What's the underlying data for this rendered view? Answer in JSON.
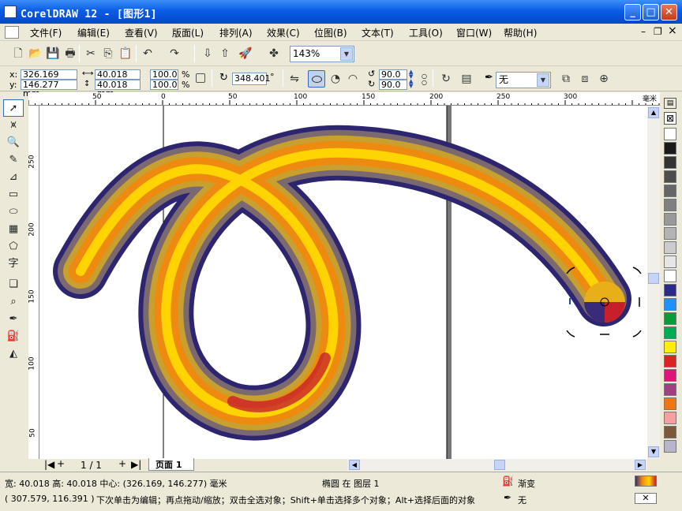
{
  "window": {
    "title": "CorelDRAW 12 - [图形1]",
    "min": "_",
    "max": "□",
    "close": "✕"
  },
  "menu": [
    {
      "label": "文件(F)"
    },
    {
      "label": "编辑(E)"
    },
    {
      "label": "查看(V)"
    },
    {
      "label": "版面(L)"
    },
    {
      "label": "排列(A)"
    },
    {
      "label": "效果(C)"
    },
    {
      "label": "位图(B)"
    },
    {
      "label": "文本(T)"
    },
    {
      "label": "工具(O)"
    },
    {
      "label": "窗口(W)"
    },
    {
      "label": "帮助(H)"
    }
  ],
  "doc_controls": {
    "min": "–",
    "restore": "❐",
    "close": "×"
  },
  "toolbar": {
    "zoom": "143%"
  },
  "property_bar": {
    "x_label": "x:",
    "x_value": "326.169 mm",
    "y_label": "y:",
    "y_value": "146.277 mm",
    "w_value": "40.018 mm",
    "h_value": "40.018 mm",
    "scale_x": "100.0",
    "scale_y": "100.0",
    "pct": "%",
    "angle": "348.401",
    "deg": "°",
    "arc_start": "90.0",
    "arc_end": "90.0",
    "outline": "无"
  },
  "ruler": {
    "unit": "毫米",
    "h_ticks": [
      "50",
      "0",
      "50",
      "100",
      "150",
      "200",
      "250",
      "300"
    ],
    "v_ticks": [
      "250",
      "200",
      "150",
      "100",
      "50"
    ]
  },
  "page": {
    "count": "1 / 1",
    "tab": "页面 1",
    "first": "|◀",
    "add": "+",
    "last": "▶|"
  },
  "status": {
    "dims": "宽: 40.018 高: 40.018 中心: (326.169, 146.277) 毫米",
    "object": "椭圆 在 图层 1",
    "fill_label": "渐变",
    "coords": "( 307.579, 116.391 )",
    "hint": "下次单击为编辑；再点拖动/缩放；双击全选对象；Shift+单击选择多个对象；Alt+选择后面的对象",
    "outline_label": "无"
  },
  "colors": {
    "accent": "#0a5de6",
    "tube_dark": "#3a2a7a",
    "tube_orange": "#ee8a10",
    "tube_yellow": "#ffd400",
    "tube_red": "#c8202a"
  },
  "palette": [
    "#ffffff",
    "#1a1a1a",
    "#333333",
    "#4d4d4d",
    "#666666",
    "#808080",
    "#999999",
    "#b3b3b3",
    "#cccccc",
    "#e6e6e6",
    "#ffffff",
    "#2a2a8a",
    "#1e90ff",
    "#0a9a3a",
    "#00aa55",
    "#ffee00",
    "#dd2222",
    "#e0157a",
    "#a04080",
    "#ee7711",
    "#f4a0a0",
    "#7a5a3a",
    "#b8b4cc"
  ]
}
